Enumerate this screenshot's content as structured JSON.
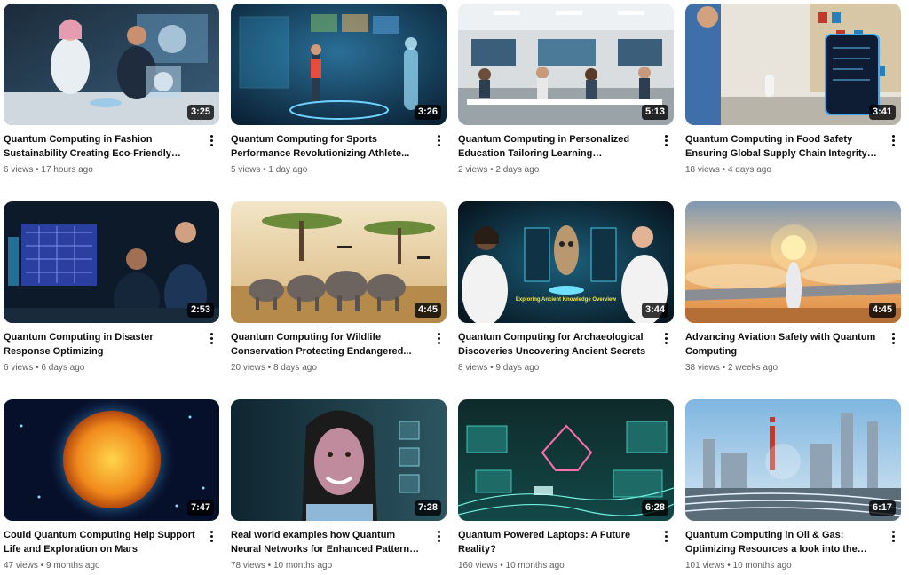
{
  "videos": [
    {
      "title": "Quantum Computing in Fashion Sustainability Creating Eco-Friendly Designs",
      "views": "6 views",
      "age": "17 hours ago",
      "duration": "3:25",
      "scene": "lab-fashion"
    },
    {
      "title": "Quantum Computing for Sports Performance Revolutionizing Athlete...",
      "views": "5 views",
      "age": "1 day ago",
      "duration": "3:26",
      "scene": "sports-holo"
    },
    {
      "title": "Quantum Computing in Personalized Education Tailoring Learning Experiences",
      "views": "2 views",
      "age": "2 days ago",
      "duration": "5:13",
      "scene": "classroom"
    },
    {
      "title": "Quantum Computing in Food Safety Ensuring Global Supply Chain Integrity -...",
      "views": "18 views",
      "age": "4 days ago",
      "duration": "3:41",
      "scene": "supermarket"
    },
    {
      "title": "Quantum Computing in Disaster Response Optimizing",
      "views": "6 views",
      "age": "6 days ago",
      "duration": "2:53",
      "scene": "control-room"
    },
    {
      "title": "Quantum Computing for Wildlife Conservation Protecting Endangered...",
      "views": "20 views",
      "age": "8 days ago",
      "duration": "4:45",
      "scene": "elephants"
    },
    {
      "title": "Quantum Computing for Archaeological Discoveries Uncovering Ancient Secrets",
      "views": "8 views",
      "age": "9 days ago",
      "duration": "3:44",
      "scene": "archaeology"
    },
    {
      "title": "Advancing Aviation Safety with Quantum Computing",
      "views": "38 views",
      "age": "2 weeks ago",
      "duration": "4:45",
      "scene": "aviation"
    },
    {
      "title": "Could Quantum Computing Help Support Life and Exploration on Mars",
      "views": "47 views",
      "age": "9 months ago",
      "duration": "7:47",
      "scene": "sun"
    },
    {
      "title": "Real world examples how Quantum Neural Networks for Enhanced Pattern Recognitio...",
      "views": "78 views",
      "age": "10 months ago",
      "duration": "7:28",
      "scene": "face"
    },
    {
      "title": "Quantum Powered Laptops: A Future Reality?",
      "views": "160 views",
      "age": "10 months ago",
      "duration": "6:28",
      "scene": "teal-circuit"
    },
    {
      "title": "Quantum Computing in Oil & Gas: Optimizing Resources a look into the future.",
      "views": "101 views",
      "age": "10 months ago",
      "duration": "6:17",
      "scene": "refinery"
    }
  ],
  "thumb0": {
    "caption": ""
  },
  "thumb6": {
    "caption": "Exploring Ancient Knowledge Overview"
  },
  "icons": {
    "more": "more-vertical-icon"
  }
}
